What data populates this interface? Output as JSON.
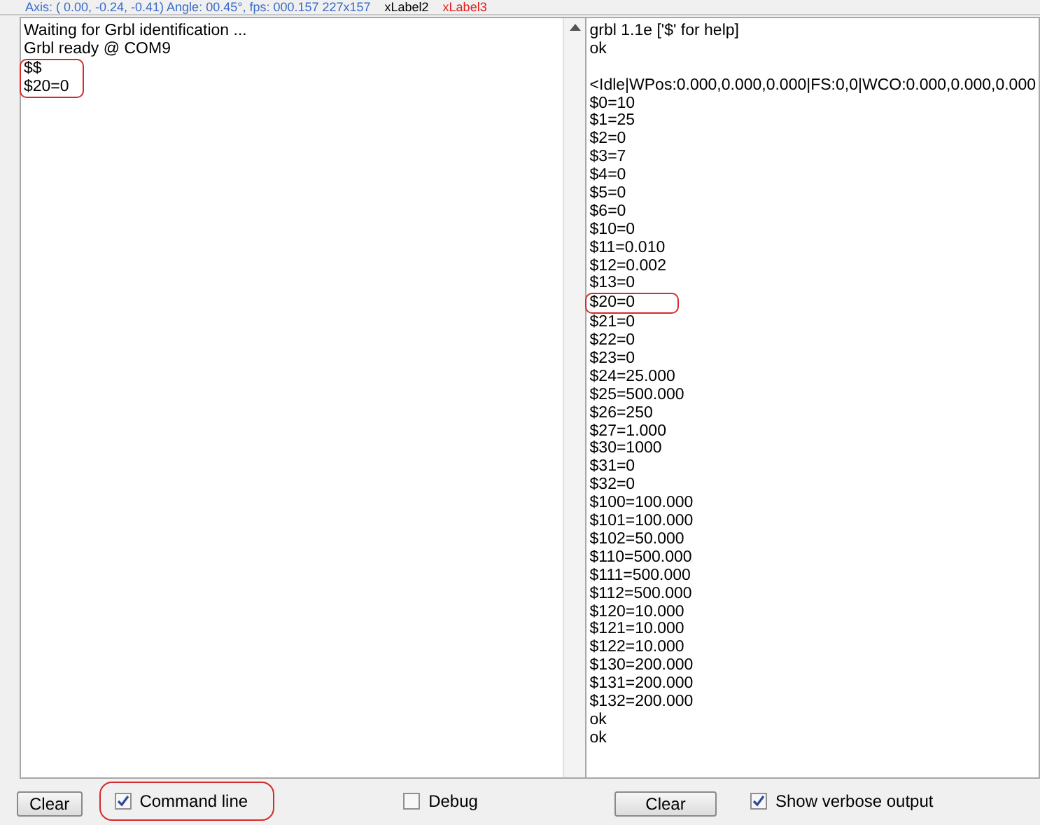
{
  "top_strip": {
    "text": "Axis: ( 0.00, -0.24, -0.41) Angle: 00.45°, fps: 000.157   227x157",
    "label_2": "xLabel2",
    "label_3": "xLabel3"
  },
  "left_log": {
    "lines": [
      {
        "text": "Waiting for Grbl identification ...",
        "highlighted": false
      },
      {
        "text": "Grbl ready @ COM9",
        "highlighted": false
      },
      {
        "text": "$$",
        "highlighted": true
      },
      {
        "text": "$20=0",
        "highlighted": true
      }
    ]
  },
  "right_log": {
    "lines": [
      {
        "text": "grbl 1.1e ['$' for help]",
        "highlighted": false,
        "blank_before": false
      },
      {
        "text": "ok",
        "highlighted": false,
        "blank_before": false
      },
      {
        "text": "<Idle|WPos:0.000,0.000,0.000|FS:0,0|WCO:0.000,0.000,0.000",
        "highlighted": false,
        "blank_before": true
      },
      {
        "text": "$0=10",
        "highlighted": false,
        "blank_before": false
      },
      {
        "text": "$1=25",
        "highlighted": false,
        "blank_before": false
      },
      {
        "text": "$2=0",
        "highlighted": false,
        "blank_before": false
      },
      {
        "text": "$3=7",
        "highlighted": false,
        "blank_before": false
      },
      {
        "text": "$4=0",
        "highlighted": false,
        "blank_before": false
      },
      {
        "text": "$5=0",
        "highlighted": false,
        "blank_before": false
      },
      {
        "text": "$6=0",
        "highlighted": false,
        "blank_before": false
      },
      {
        "text": "$10=0",
        "highlighted": false,
        "blank_before": false
      },
      {
        "text": "$11=0.010",
        "highlighted": false,
        "blank_before": false
      },
      {
        "text": "$12=0.002",
        "highlighted": false,
        "blank_before": false
      },
      {
        "text": "$13=0",
        "highlighted": false,
        "blank_before": false
      },
      {
        "text": "$20=0",
        "highlighted": true,
        "blank_before": false
      },
      {
        "text": "$21=0",
        "highlighted": false,
        "blank_before": false
      },
      {
        "text": "$22=0",
        "highlighted": false,
        "blank_before": false
      },
      {
        "text": "$23=0",
        "highlighted": false,
        "blank_before": false
      },
      {
        "text": "$24=25.000",
        "highlighted": false,
        "blank_before": false
      },
      {
        "text": "$25=500.000",
        "highlighted": false,
        "blank_before": false
      },
      {
        "text": "$26=250",
        "highlighted": false,
        "blank_before": false
      },
      {
        "text": "$27=1.000",
        "highlighted": false,
        "blank_before": false
      },
      {
        "text": "$30=1000",
        "highlighted": false,
        "blank_before": false
      },
      {
        "text": "$31=0",
        "highlighted": false,
        "blank_before": false
      },
      {
        "text": "$32=0",
        "highlighted": false,
        "blank_before": false
      },
      {
        "text": "$100=100.000",
        "highlighted": false,
        "blank_before": false
      },
      {
        "text": "$101=100.000",
        "highlighted": false,
        "blank_before": false
      },
      {
        "text": "$102=50.000",
        "highlighted": false,
        "blank_before": false
      },
      {
        "text": "$110=500.000",
        "highlighted": false,
        "blank_before": false
      },
      {
        "text": "$111=500.000",
        "highlighted": false,
        "blank_before": false
      },
      {
        "text": "$112=500.000",
        "highlighted": false,
        "blank_before": false
      },
      {
        "text": "$120=10.000",
        "highlighted": false,
        "blank_before": false
      },
      {
        "text": "$121=10.000",
        "highlighted": false,
        "blank_before": false
      },
      {
        "text": "$122=10.000",
        "highlighted": false,
        "blank_before": false
      },
      {
        "text": "$130=200.000",
        "highlighted": false,
        "blank_before": false
      },
      {
        "text": "$131=200.000",
        "highlighted": false,
        "blank_before": false
      },
      {
        "text": "$132=200.000",
        "highlighted": false,
        "blank_before": false
      },
      {
        "text": "ok",
        "highlighted": false,
        "blank_before": false
      },
      {
        "text": "ok",
        "highlighted": false,
        "blank_before": false
      }
    ]
  },
  "left_controls": {
    "clear_button": "Clear",
    "checkboxes": [
      {
        "label": "Command line",
        "checked": true,
        "highlighted": true
      },
      {
        "label": "Debug",
        "checked": false,
        "highlighted": false
      }
    ]
  },
  "right_controls": {
    "clear_button": "Clear",
    "checkboxes": [
      {
        "label": "Show verbose output",
        "checked": true,
        "highlighted": false
      }
    ]
  }
}
